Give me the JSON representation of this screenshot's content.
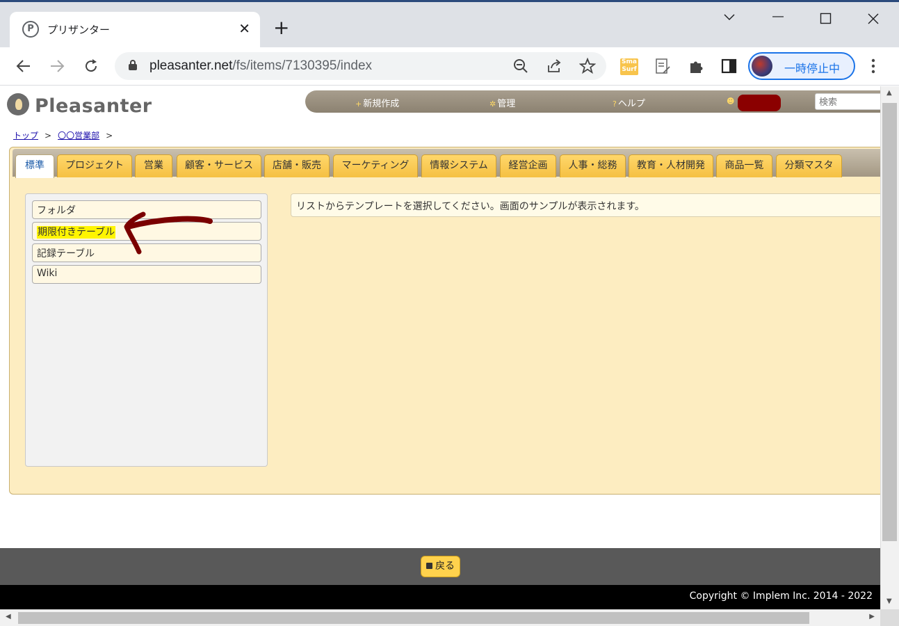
{
  "browser": {
    "tab_favicon": "P",
    "tab_title": "プリザンター",
    "tab_close": "✕",
    "new_tab": "+",
    "url_host": "pleasanter.net",
    "url_path": "/fs/items/7130395/index",
    "ext_smasurf": "Sma Surf",
    "profile_label": "一時停止中",
    "icons": [
      "back-icon",
      "forward-icon",
      "reload-icon",
      "lock-icon",
      "zoom-out-icon",
      "share-icon",
      "star-icon",
      "smasurf-icon",
      "notes-icon",
      "puzzle-icon",
      "side-panel-icon",
      "more-icon"
    ]
  },
  "app": {
    "logo_text": "Pleasanter",
    "nav": {
      "new": "新規作成",
      "manage": "管理",
      "help": "ヘルプ"
    },
    "search_placeholder": "検索",
    "breadcrumb": [
      "トップ",
      "〇〇営業部"
    ],
    "breadcrumb_sep": ">",
    "tabs": [
      "標準",
      "プロジェクト",
      "営業",
      "顧客・サービス",
      "店舗・販売",
      "マーケティング",
      "情報システム",
      "経営企画",
      "人事・総務",
      "教育・人材開発",
      "商品一覧",
      "分類マスタ"
    ],
    "templates": [
      "フォルダ",
      "期限付きテーブル",
      "記録テーブル",
      "Wiki"
    ],
    "info_message": "リストからテンプレートを選択してください。画面のサンプルが表示されます。",
    "back_button": "戻る",
    "copyright": "Copyright © Implem Inc. 2014 - 2022"
  },
  "colors": {
    "panel_bg": "#fdedc1",
    "tab_gold": "#f5c042",
    "highlight": "#fff500",
    "annotation_arrow": "#7a0000",
    "footer_gray": "#595959"
  }
}
